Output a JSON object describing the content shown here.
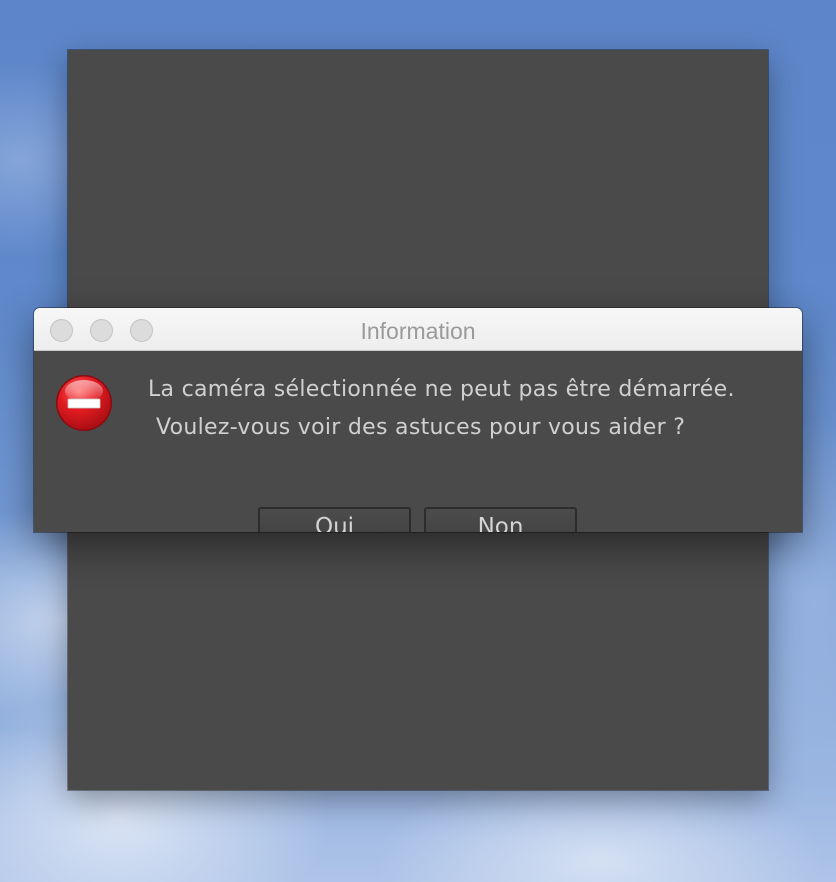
{
  "dialog": {
    "title": "Information",
    "icon": "stop-icon",
    "message_line1": "La caméra sélectionnée ne peut pas être démarrée.",
    "message_line2": "Voulez-vous voir des astuces pour vous aider ?",
    "buttons": {
      "yes_mnemonic": "O",
      "yes_rest": "ui",
      "no_mnemonic": "N",
      "no_rest": "on"
    }
  },
  "colors": {
    "dialog_background": "#4a4a4a",
    "titlebar": "#efefef",
    "stop_icon_red": "#d8141c",
    "desktop_sky": "#5f89cb"
  }
}
